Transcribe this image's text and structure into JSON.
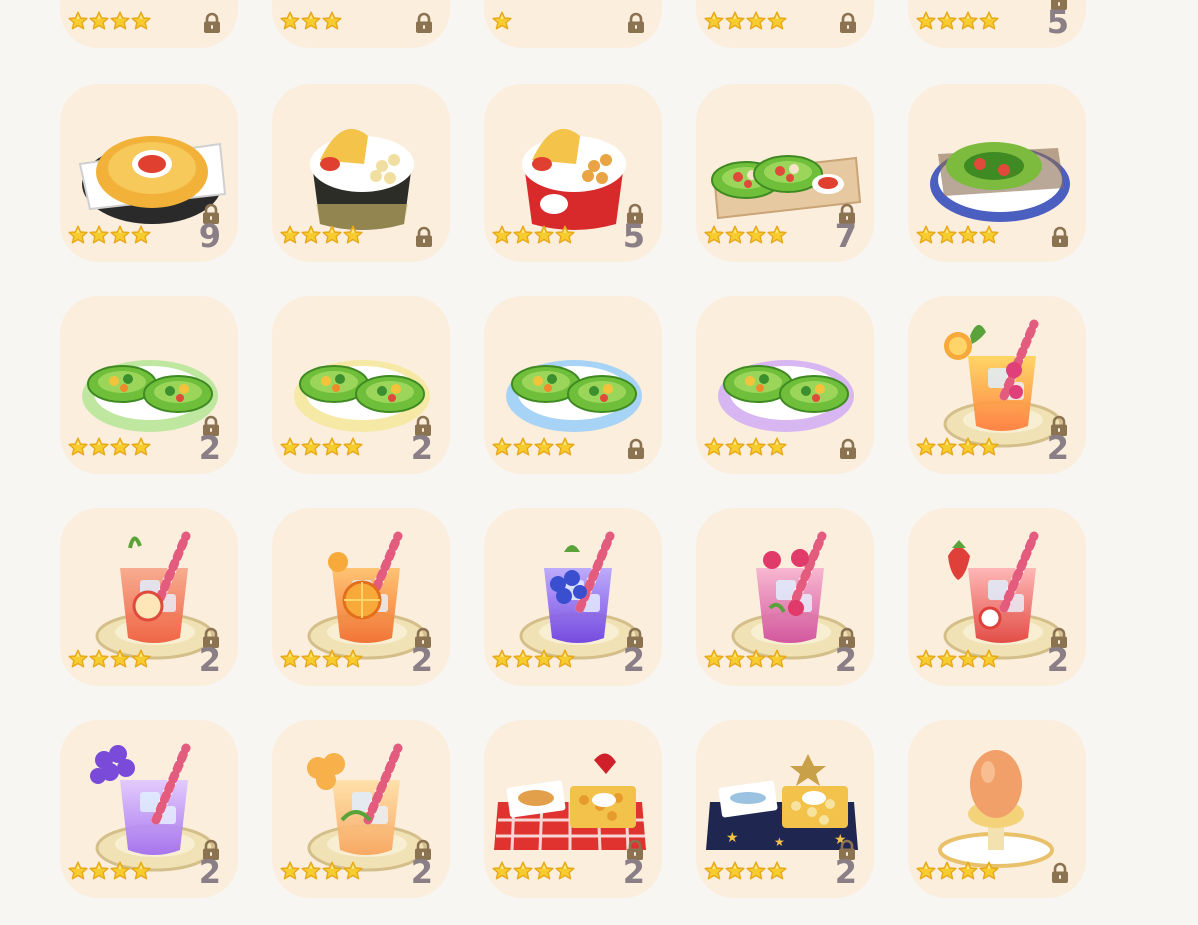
{
  "colors": {
    "background": "#f8f6f2",
    "tile": "#fbeedd",
    "count_text": "#8a7f86",
    "star_fill": "#f6cc2e",
    "star_outline": "#e7a81a",
    "lock": "#8b7352"
  },
  "items": [
    {
      "name": "plated-dish-1",
      "stars": 4,
      "count": "",
      "food": "plate-top"
    },
    {
      "name": "plated-dish-2",
      "stars": 3,
      "count": "",
      "food": "plate-top"
    },
    {
      "name": "plated-dish-3",
      "stars": 1,
      "count": "",
      "food": "plate-top"
    },
    {
      "name": "popcorn-bucket-checkered",
      "stars": 4,
      "count": "",
      "food": "popcorn-dark"
    },
    {
      "name": "popcorn-bucket-striped",
      "stars": 4,
      "count": "5",
      "food": "popcorn-red"
    },
    {
      "name": "nachos-platter",
      "stars": 4,
      "count": "9",
      "food": "nachos"
    },
    {
      "name": "fries-and-nuggets-dark-cup",
      "stars": 4,
      "count": "",
      "food": "fries-dark"
    },
    {
      "name": "fries-and-nuggets-red-cup",
      "stars": 4,
      "count": "5",
      "food": "fries-red"
    },
    {
      "name": "lettuce-wraps-tray",
      "stars": 4,
      "count": "7",
      "food": "wraps-tray"
    },
    {
      "name": "avocado-salad-plate",
      "stars": 4,
      "count": "",
      "food": "avocado"
    },
    {
      "name": "lettuce-cups-green-plate",
      "stars": 4,
      "count": "2",
      "food": "cups-green"
    },
    {
      "name": "lettuce-cups-yellow-plate",
      "stars": 4,
      "count": "2",
      "food": "cups-yellow"
    },
    {
      "name": "lettuce-cups-blue-plate",
      "stars": 4,
      "count": "",
      "food": "cups-blue"
    },
    {
      "name": "lettuce-cups-purple-plate",
      "stars": 4,
      "count": "",
      "food": "cups-purple"
    },
    {
      "name": "fruit-punch-drink",
      "stars": 4,
      "count": "2",
      "food": "drink-punch"
    },
    {
      "name": "apple-drink",
      "stars": 4,
      "count": "2",
      "food": "drink-apple"
    },
    {
      "name": "orange-drink",
      "stars": 4,
      "count": "2",
      "food": "drink-orange"
    },
    {
      "name": "blueberry-drink",
      "stars": 4,
      "count": "2",
      "food": "drink-blueberry"
    },
    {
      "name": "raspberry-drink",
      "stars": 4,
      "count": "2",
      "food": "drink-raspberry"
    },
    {
      "name": "strawberry-drink",
      "stars": 4,
      "count": "2",
      "food": "drink-strawberry"
    },
    {
      "name": "grape-drink",
      "stars": 4,
      "count": "2",
      "food": "drink-grape"
    },
    {
      "name": "peach-drink",
      "stars": 4,
      "count": "2",
      "food": "drink-peach"
    },
    {
      "name": "picnic-box-red",
      "stars": 4,
      "count": "2",
      "food": "box-red"
    },
    {
      "name": "picnic-box-navy",
      "stars": 4,
      "count": "2",
      "food": "box-navy"
    },
    {
      "name": "egg-cup",
      "stars": 4,
      "count": "",
      "food": "egg"
    }
  ]
}
